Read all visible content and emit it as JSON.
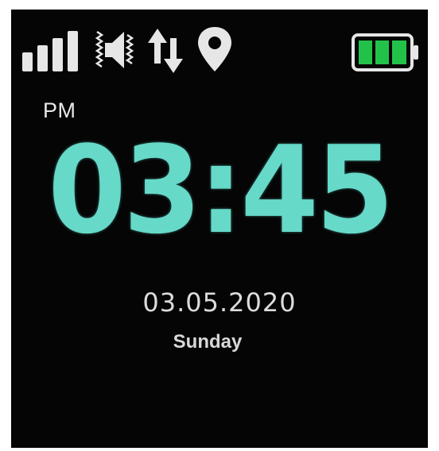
{
  "status_bar": {
    "icons": [
      "signal-icon",
      "volume-icon",
      "data-transfer-icon",
      "location-icon",
      "battery-icon"
    ],
    "signal_bars": 4,
    "battery_level": 1.0,
    "battery_color": "#22c24a"
  },
  "clock": {
    "ampm": "PM",
    "time": "03:45",
    "color": "#66d9c9"
  },
  "date": {
    "text": "03.05.2020",
    "weekday": "Sunday"
  }
}
